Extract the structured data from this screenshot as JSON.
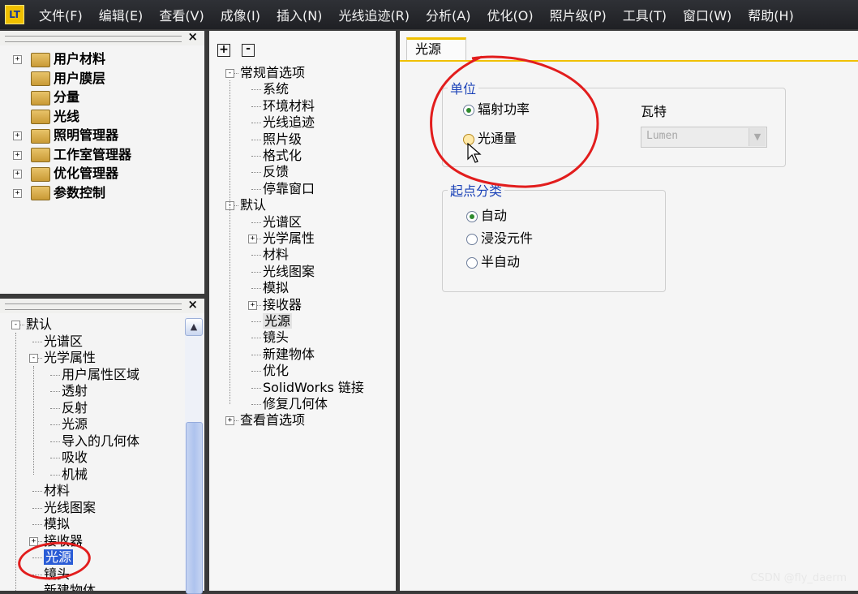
{
  "menubar": {
    "app_icon": "LT",
    "items": [
      "文件(F)",
      "编辑(E)",
      "查看(V)",
      "成像(I)",
      "插入(N)",
      "光线追迹(R)",
      "分析(A)",
      "优化(O)",
      "照片级(P)",
      "工具(T)",
      "窗口(W)",
      "帮助(H)"
    ]
  },
  "panel_top_left": {
    "close": "×",
    "items": [
      {
        "label": "用户材料",
        "expandable": true
      },
      {
        "label": "用户膜层",
        "expandable": false
      },
      {
        "label": "分量",
        "expandable": false
      },
      {
        "label": "光线",
        "expandable": false
      },
      {
        "label": "照明管理器",
        "expandable": true
      },
      {
        "label": "工作室管理器",
        "expandable": true
      },
      {
        "label": "优化管理器",
        "expandable": true
      },
      {
        "label": "参数控制",
        "expandable": true
      }
    ]
  },
  "panel_bottom_left": {
    "close": "×",
    "rows": [
      {
        "label": "默认",
        "indent": 0,
        "pm": "-"
      },
      {
        "label": "光谱区",
        "indent": 1,
        "pm": ""
      },
      {
        "label": "光学属性",
        "indent": 1,
        "pm": "-"
      },
      {
        "label": "用户属性区域",
        "indent": 2,
        "pm": ""
      },
      {
        "label": "透射",
        "indent": 2,
        "pm": ""
      },
      {
        "label": "反射",
        "indent": 2,
        "pm": ""
      },
      {
        "label": "光源",
        "indent": 2,
        "pm": ""
      },
      {
        "label": "导入的几何体",
        "indent": 2,
        "pm": ""
      },
      {
        "label": "吸收",
        "indent": 2,
        "pm": ""
      },
      {
        "label": "机械",
        "indent": 2,
        "pm": ""
      },
      {
        "label": "材料",
        "indent": 1,
        "pm": ""
      },
      {
        "label": "光线图案",
        "indent": 1,
        "pm": ""
      },
      {
        "label": "模拟",
        "indent": 1,
        "pm": ""
      },
      {
        "label": "接收器",
        "indent": 1,
        "pm": "+"
      },
      {
        "label": "光源",
        "indent": 1,
        "pm": "",
        "selected": true
      },
      {
        "label": "镜头",
        "indent": 1,
        "pm": ""
      },
      {
        "label": "新建物体",
        "indent": 1,
        "pm": ""
      }
    ]
  },
  "panel_middle": {
    "expand_all": "+",
    "collapse_all": "-",
    "rows": [
      {
        "label": "常规首选项",
        "indent": 0,
        "pm": "-"
      },
      {
        "label": "系统",
        "indent": 1,
        "pm": ""
      },
      {
        "label": "环境材料",
        "indent": 1,
        "pm": ""
      },
      {
        "label": "光线追迹",
        "indent": 1,
        "pm": ""
      },
      {
        "label": "照片级",
        "indent": 1,
        "pm": ""
      },
      {
        "label": "格式化",
        "indent": 1,
        "pm": ""
      },
      {
        "label": "反馈",
        "indent": 1,
        "pm": ""
      },
      {
        "label": "停靠窗口",
        "indent": 1,
        "pm": ""
      },
      {
        "label": "默认",
        "indent": 0,
        "pm": "-"
      },
      {
        "label": "光谱区",
        "indent": 1,
        "pm": ""
      },
      {
        "label": "光学属性",
        "indent": 1,
        "pm": "+"
      },
      {
        "label": "材料",
        "indent": 1,
        "pm": ""
      },
      {
        "label": "光线图案",
        "indent": 1,
        "pm": ""
      },
      {
        "label": "模拟",
        "indent": 1,
        "pm": ""
      },
      {
        "label": "接收器",
        "indent": 1,
        "pm": "+"
      },
      {
        "label": "光源",
        "indent": 1,
        "pm": "",
        "selected": true
      },
      {
        "label": "镜头",
        "indent": 1,
        "pm": ""
      },
      {
        "label": "新建物体",
        "indent": 1,
        "pm": ""
      },
      {
        "label": "优化",
        "indent": 1,
        "pm": ""
      },
      {
        "label": "SolidWorks 链接",
        "indent": 1,
        "pm": ""
      },
      {
        "label": "修复几何体",
        "indent": 1,
        "pm": ""
      },
      {
        "label": "查看首选项",
        "indent": 0,
        "pm": "+"
      }
    ]
  },
  "settings": {
    "tab": "光源",
    "unit_group": {
      "legend": "单位",
      "options": [
        "辐射功率",
        "光通量"
      ],
      "selected": 0,
      "unit_label": "瓦特",
      "unit_combo": "Lumen"
    },
    "origin_group": {
      "legend": "起点分类",
      "options": [
        "自动",
        "浸没元件",
        "半自动"
      ],
      "selected": 0
    }
  },
  "watermark": "CSDN @fly_daerm",
  "colors": {
    "accent": "#f0c000",
    "legend": "#1c43b8",
    "annotation": "#e21d1d",
    "selection": "#2a5cd6"
  }
}
